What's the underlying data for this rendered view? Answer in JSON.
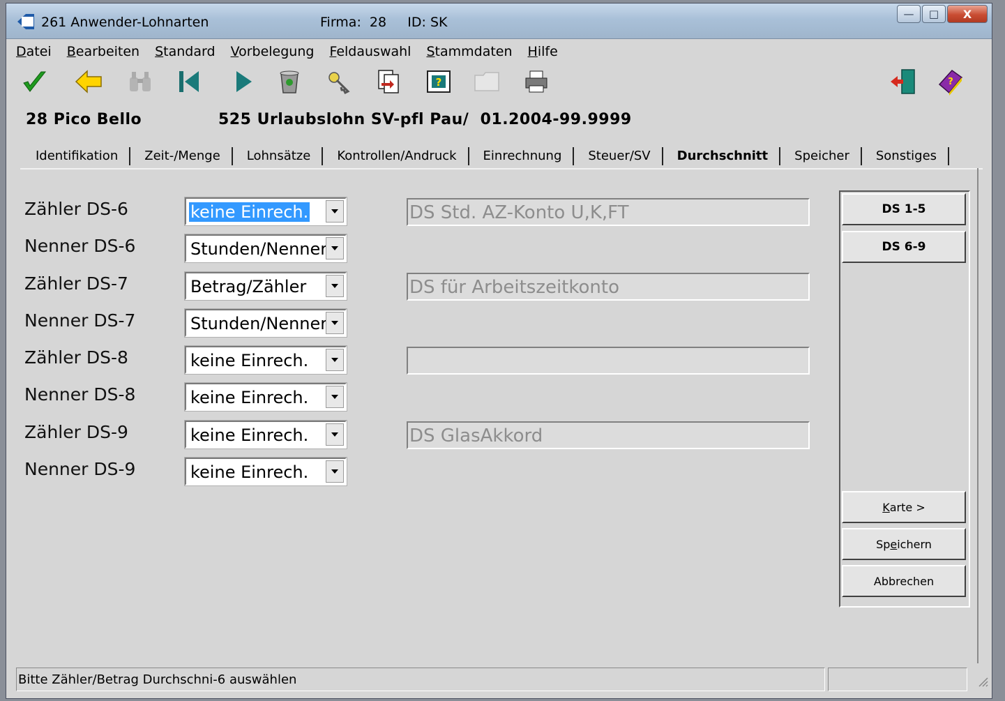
{
  "window": {
    "title": "261 Anwender-Lohnarten",
    "firma": "Firma:  28     ID: SK",
    "controls": {
      "minimize": "—",
      "maximize": "□",
      "close": "X"
    }
  },
  "menu": [
    {
      "first": "D",
      "rest": "atei"
    },
    {
      "first": "B",
      "rest": "earbeiten"
    },
    {
      "first": "S",
      "rest": "tandard"
    },
    {
      "first": "V",
      "rest": "orbelegung"
    },
    {
      "first": "F",
      "rest": "eldauswahl"
    },
    {
      "first": "S",
      "rest": "tammdaten"
    },
    {
      "first": "H",
      "rest": "ilfe"
    }
  ],
  "toolbar": [
    "checkmark-icon",
    "back-arrow-icon",
    "binoculars-icon",
    "first-record-icon",
    "next-record-icon",
    "recycle-bin-icon",
    "key-icon",
    "export-icon",
    "help-window-icon",
    "folder-icon",
    "printer-icon",
    "exit-door-icon",
    "help-book-icon"
  ],
  "header": {
    "company": "28 Pico Bello",
    "lohnart": "525 Urlaubslohn SV-pfl Pau/  01.2004-99.9999"
  },
  "tabs": [
    {
      "label": "Identifikation",
      "active": false
    },
    {
      "label": "Zeit-/Menge",
      "active": false
    },
    {
      "label": "Lohnsätze",
      "active": false
    },
    {
      "label": "Kontrollen/Andruck",
      "active": false
    },
    {
      "label": "Einrechnung",
      "active": false
    },
    {
      "label": "Steuer/SV",
      "active": false
    },
    {
      "label": "Durchschnitt",
      "active": true
    },
    {
      "label": "Speicher",
      "active": false
    },
    {
      "label": "Sonstiges",
      "active": false
    }
  ],
  "rows": [
    {
      "label": "Zähler DS-6",
      "value": "keine Einrech.",
      "selected": true
    },
    {
      "label": "Nenner DS-6",
      "value": "Stunden/Nenner"
    },
    {
      "label": "Zähler DS-7",
      "value": "Betrag/Zähler"
    },
    {
      "label": "Nenner DS-7",
      "value": "Stunden/Nenner"
    },
    {
      "label": "Zähler DS-8",
      "value": "keine Einrech."
    },
    {
      "label": "Nenner DS-8",
      "value": "keine Einrech."
    },
    {
      "label": "Zähler DS-9",
      "value": "keine Einrech."
    },
    {
      "label": "Nenner DS-9",
      "value": "keine Einrech."
    }
  ],
  "descriptions": [
    "DS Std. AZ-Konto U,K,FT",
    "DS für Arbeitszeitkonto",
    "",
    "DS GlasAkkord"
  ],
  "side_buttons": {
    "ds15": "DS 1-5",
    "ds69": "DS 6-9",
    "karte": {
      "pre": "",
      "u": "K",
      "post": "arte >"
    },
    "speichern": {
      "pre": "Sp",
      "u": "e",
      "post": "ichern"
    },
    "abbrechen": "Abbrechen"
  },
  "status": {
    "message": "Bitte Zähler/Betrag Durchschni-6 auswählen"
  }
}
